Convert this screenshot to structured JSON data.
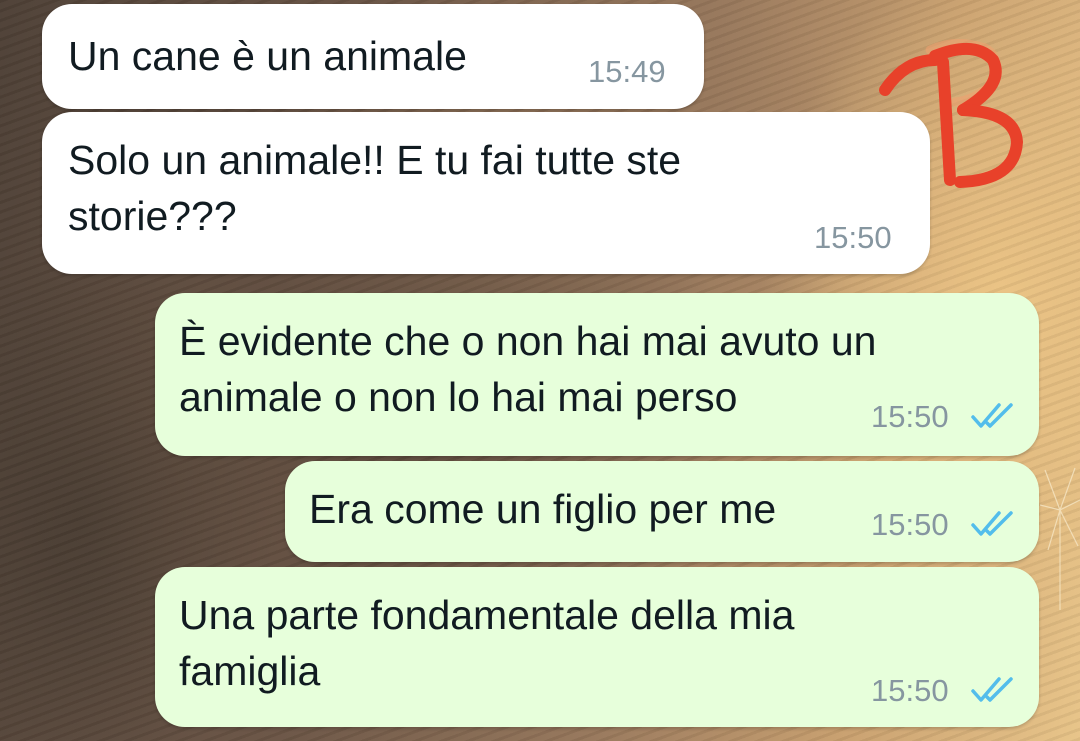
{
  "conversation": {
    "sticker_letter": "B",
    "messages": [
      {
        "direction": "incoming",
        "text": "Un cane è un animale",
        "time": "15:49"
      },
      {
        "direction": "incoming",
        "text": "Solo un animale!! E tu fai tutte ste\nstorie???",
        "time": "15:50"
      },
      {
        "direction": "outgoing",
        "text": "È evidente che o non hai mai avuto un\nanimale o non lo hai mai perso",
        "time": "15:50",
        "status_icon": "double-check-read-icon"
      },
      {
        "direction": "outgoing",
        "text": "Era come un figlio per me",
        "time": "15:50",
        "status_icon": "double-check-read-icon"
      },
      {
        "direction": "outgoing",
        "text": "Una parte fondamentale della mia\nfamiglia",
        "time": "15:50",
        "status_icon": "double-check-read-icon"
      }
    ]
  },
  "colors": {
    "incoming_bubble": "#ffffff",
    "outgoing_bubble": "#e7ffdb",
    "read_ticks": "#53bdeb",
    "timestamp": "#8696a0",
    "sticker": "#e8412a"
  }
}
